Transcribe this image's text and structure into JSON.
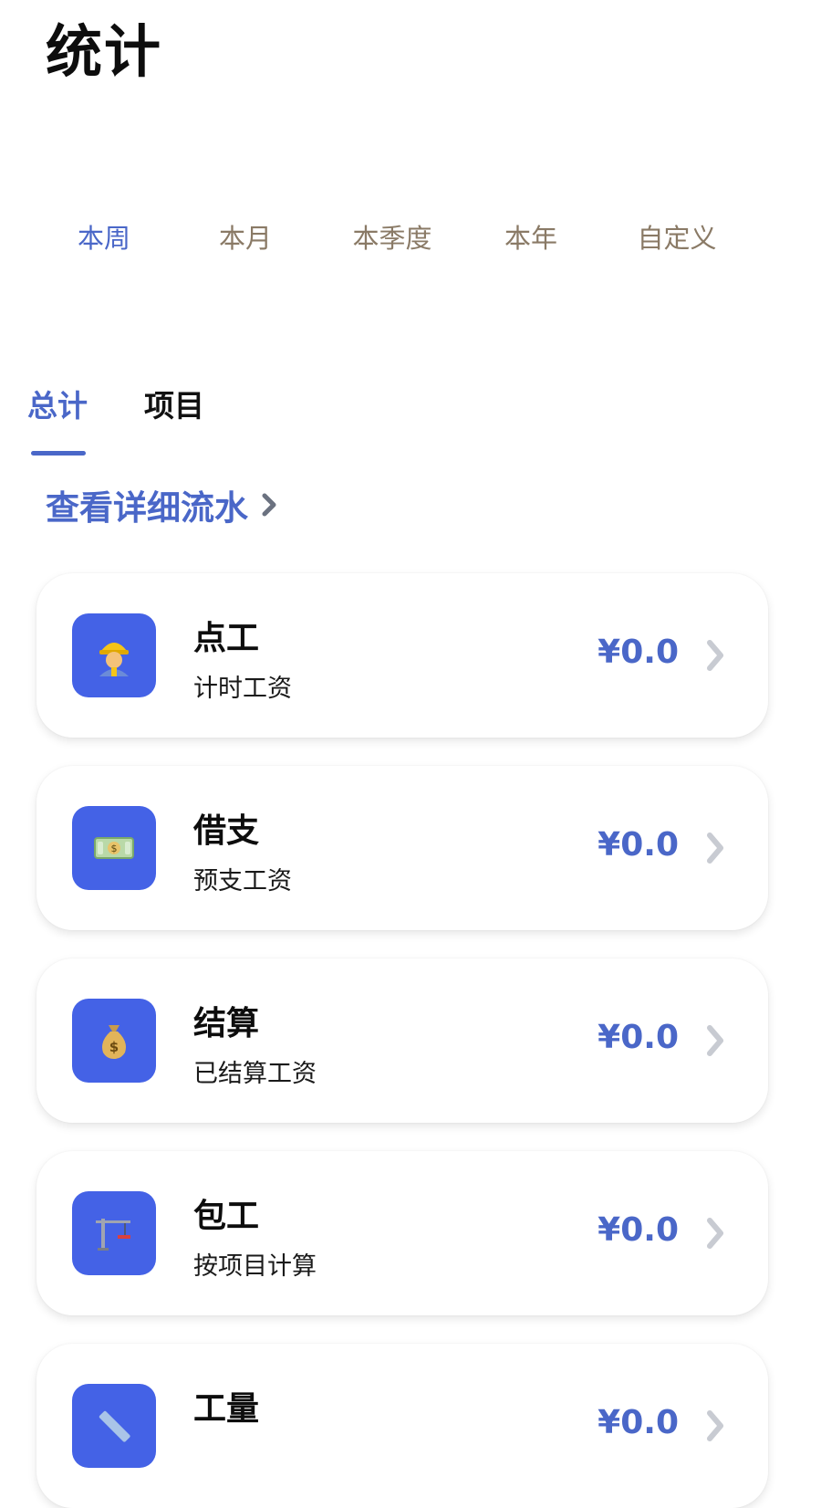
{
  "header": {
    "title": "统计"
  },
  "period_tabs": [
    {
      "label": "本周",
      "active": true
    },
    {
      "label": "本月",
      "active": false
    },
    {
      "label": "本季度",
      "active": false
    },
    {
      "label": "本年",
      "active": false
    },
    {
      "label": "自定义",
      "active": false
    }
  ],
  "main_tabs": [
    {
      "label": "总计",
      "active": true
    },
    {
      "label": "项目",
      "active": false
    }
  ],
  "detail_link": {
    "label": "查看详细流水",
    "icon": "chevron-right-icon"
  },
  "cards": [
    {
      "title": "点工",
      "subtitle": "计时工资",
      "amount": "¥0.0",
      "icon": "worker-icon"
    },
    {
      "title": "借支",
      "subtitle": "预支工资",
      "amount": "¥0.0",
      "icon": "money-bill-icon"
    },
    {
      "title": "结算",
      "subtitle": "已结算工资",
      "amount": "¥0.0",
      "icon": "money-bag-icon"
    },
    {
      "title": "包工",
      "subtitle": "按项目计算",
      "amount": "¥0.0",
      "icon": "crane-icon"
    },
    {
      "title": "工量",
      "subtitle": "",
      "amount": "¥0.0",
      "icon": "ruler-icon"
    }
  ],
  "colors": {
    "accent": "#4a67c8",
    "icon_bg": "#4462e6",
    "inactive_period": "#8a7a66",
    "chevron": "#c8cbd2"
  }
}
